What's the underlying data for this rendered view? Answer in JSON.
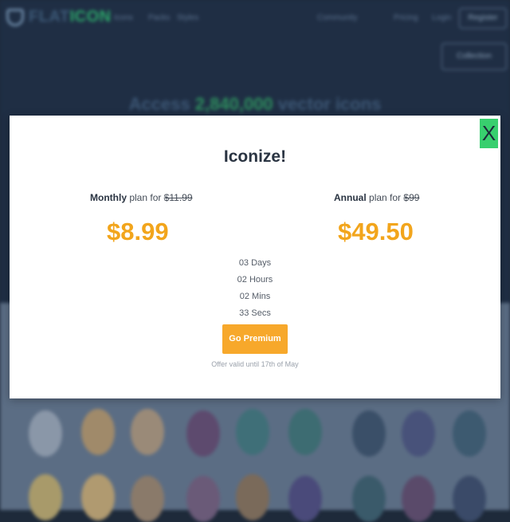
{
  "background": {
    "logo": {
      "text_main": "FLAT",
      "text_accent": "ICON"
    },
    "nav": {
      "links": [
        "Icons",
        "Packs",
        "Styles",
        "Community",
        "Pricing"
      ],
      "login": "Login",
      "register": "Register",
      "collection": "Collection"
    },
    "hero": {
      "title_prefix": "Access",
      "title_count": "2,840,000",
      "title_suffix": "vector icons"
    }
  },
  "modal": {
    "title": "Iconize!",
    "close_label": "X",
    "monthly": {
      "plan_name": "Monthly",
      "plan_text": "plan for",
      "old_price": "$11.99",
      "price": "$8.99"
    },
    "annual": {
      "plan_name": "Annual",
      "plan_text": "plan for",
      "old_price": "$99",
      "price": "$49.50"
    },
    "countdown": {
      "days": "03 Days",
      "hours": "02 Hours",
      "mins": "02 Mins",
      "secs": "33 Secs"
    },
    "cta_label": "Go Premium",
    "offer_text": "Offer valid until 17th of May"
  },
  "colors": {
    "accent_green": "#38cf6e",
    "price_orange": "#f2a51c",
    "button_orange": "#f7a82b"
  }
}
